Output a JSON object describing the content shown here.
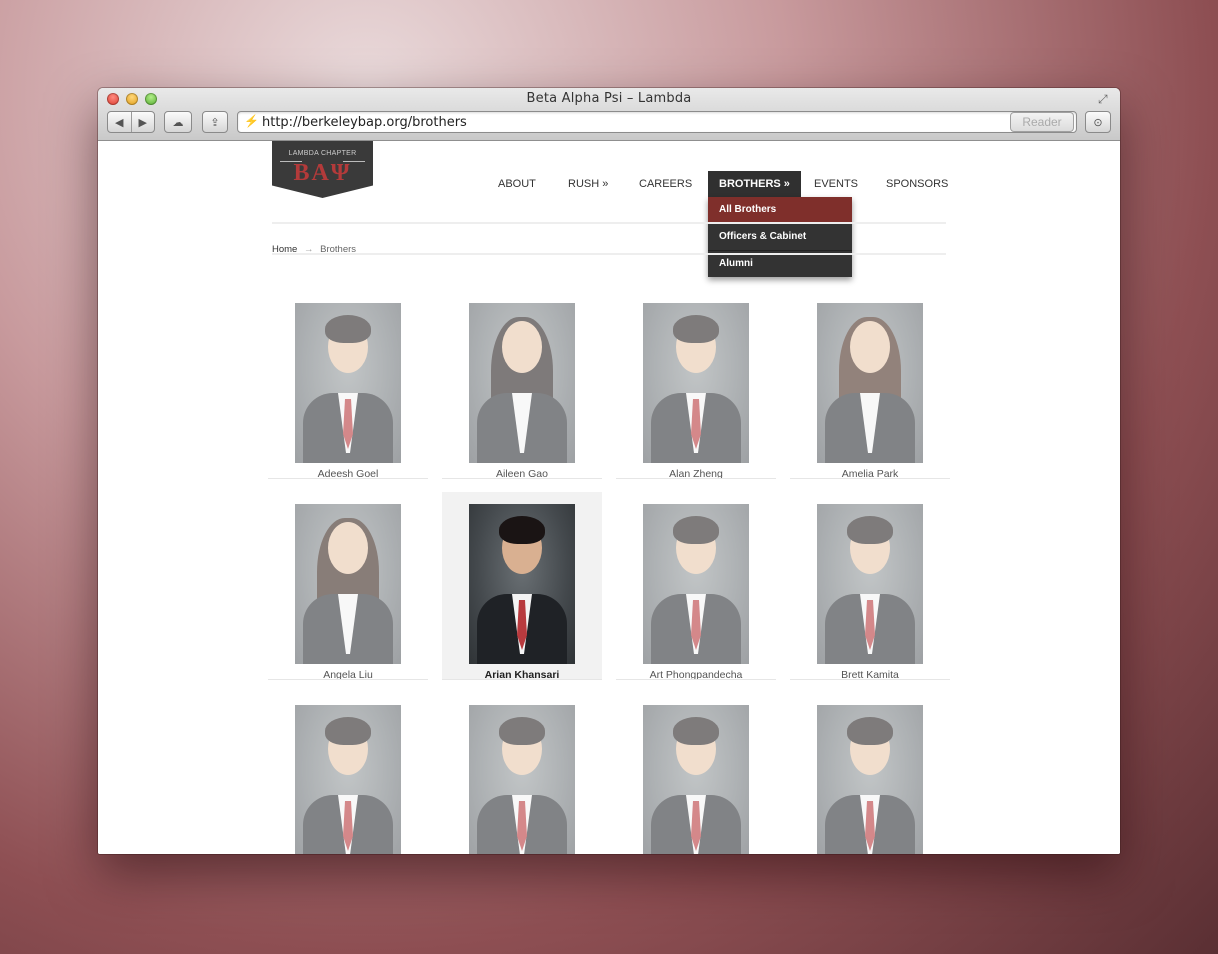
{
  "browser": {
    "title": "Beta Alpha Psi – Lambda",
    "url": "http://berkeleybap.org/brothers",
    "reader_label": "Reader",
    "back_icon": "◀",
    "forward_icon": "▶",
    "cloud_icon": "☁",
    "share_icon": "⇪",
    "download_icon": "⊙",
    "reload_icon": "↻",
    "site_icon": "⚡",
    "fullscreen_icon": "⤢"
  },
  "logo": {
    "subtitle": "LAMBDA CHAPTER",
    "letters": "ΒΑΨ"
  },
  "nav": {
    "about": "ABOUT",
    "rush": "RUSH »",
    "careers": "CAREERS",
    "brothers": "BROTHERS »",
    "events": "EVENTS",
    "sponsors": "SPONSORS"
  },
  "dropdown": [
    "All Brothers",
    "Officers & Cabinet",
    "Alumni"
  ],
  "breadcrumb": {
    "home": "Home",
    "arrow": "→",
    "current": "Brothers"
  },
  "brothers": [
    "Adeesh Goel",
    "Aileen Gao",
    "Alan Zheng",
    "Amelia Park",
    "Angela Liu",
    "Arian Khansari",
    "Art Phongpandecha",
    "Brett Kamita"
  ],
  "colors": {
    "accent": "#7f2f2b",
    "nav_dark": "#303030"
  }
}
